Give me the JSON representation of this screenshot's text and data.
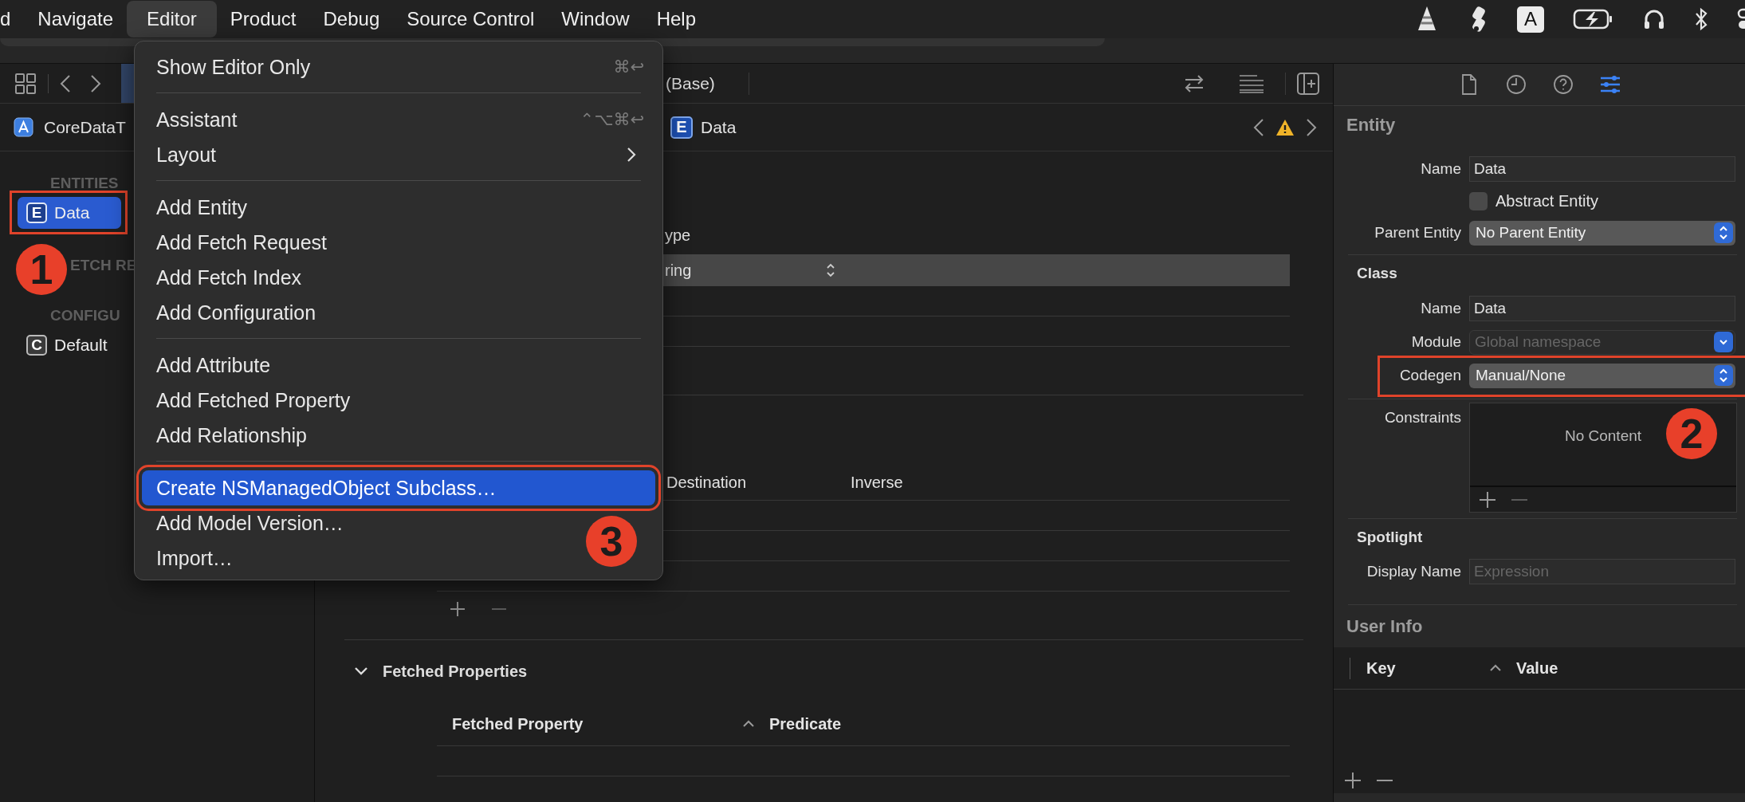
{
  "menu_bar": {
    "items": [
      {
        "label": "d",
        "selected": false
      },
      {
        "label": "Navigate",
        "selected": false
      },
      {
        "label": "Editor",
        "selected": true
      },
      {
        "label": "Product",
        "selected": false
      },
      {
        "label": "Debug",
        "selected": false
      },
      {
        "label": "Source Control",
        "selected": false
      },
      {
        "label": "Window",
        "selected": false
      },
      {
        "label": "Help",
        "selected": false
      }
    ],
    "input_source": "A"
  },
  "navigator": {
    "project": "CoreDataT",
    "annotation": "1",
    "sections": [
      {
        "title": "ENTITIES",
        "items": [
          {
            "badge": "E",
            "label": "Data",
            "selected": true,
            "highlighted": true
          }
        ]
      },
      {
        "title": "ETCH RE"
      },
      {
        "title": "CONFIGU",
        "items": [
          {
            "badge": "C",
            "label": "Default",
            "selected": false,
            "highlighted": false
          }
        ]
      }
    ]
  },
  "editor": {
    "tab_title": "(Base)",
    "breadcrumb": {
      "badge": "E",
      "label": "Data"
    },
    "attributes": {
      "column": "ype",
      "rows": [
        {
          "type": "ring",
          "selected": true
        }
      ]
    },
    "relationships": {
      "columns": [
        "Destination",
        "Inverse"
      ]
    },
    "fetched_properties": {
      "title": "Fetched Properties",
      "expanded": true,
      "columns": [
        {
          "label": "Fetched Property",
          "sorted": true
        },
        {
          "label": "Predicate",
          "sorted": false
        }
      ]
    }
  },
  "menu": {
    "annotation": "3",
    "items": [
      {
        "kind": "item",
        "label": "Show Editor Only",
        "shortcut": "⌘↩",
        "selected": false,
        "highlighted": false
      },
      {
        "kind": "separator"
      },
      {
        "kind": "item",
        "label": "Assistant",
        "shortcut": "⌃⌥⌘↩",
        "selected": false,
        "highlighted": false
      },
      {
        "kind": "item",
        "label": "Layout",
        "submenu": true,
        "selected": false,
        "highlighted": false
      },
      {
        "kind": "separator"
      },
      {
        "kind": "item",
        "label": "Add Entity",
        "selected": false,
        "highlighted": false
      },
      {
        "kind": "item",
        "label": "Add Fetch Request",
        "selected": false,
        "highlighted": false
      },
      {
        "kind": "item",
        "label": "Add Fetch Index",
        "selected": false,
        "highlighted": false
      },
      {
        "kind": "item",
        "label": "Add Configuration",
        "selected": false,
        "highlighted": false
      },
      {
        "kind": "separator"
      },
      {
        "kind": "item",
        "label": "Add Attribute",
        "selected": false,
        "highlighted": false
      },
      {
        "kind": "item",
        "label": "Add Fetched Property",
        "selected": false,
        "highlighted": false
      },
      {
        "kind": "item",
        "label": "Add Relationship",
        "selected": false,
        "highlighted": false
      },
      {
        "kind": "separator"
      },
      {
        "kind": "item",
        "label": "Create NSManagedObject Subclass…",
        "selected": true,
        "highlighted": true
      },
      {
        "kind": "item",
        "label": "Add Model Version…",
        "selected": false,
        "highlighted": false
      },
      {
        "kind": "item",
        "label": "Import…",
        "selected": false,
        "highlighted": false
      }
    ]
  },
  "inspector": {
    "tabs": [
      {
        "kind": "file",
        "selected": false
      },
      {
        "kind": "history",
        "selected": false
      },
      {
        "kind": "help",
        "selected": false
      },
      {
        "kind": "attributes",
        "selected": true
      }
    ],
    "entity": {
      "title": "Entity",
      "fields": [
        {
          "kind": "text",
          "label": "Name",
          "value": "Data",
          "highlighted": false
        },
        {
          "kind": "checkbox",
          "label": "Abstract Entity",
          "checked": false,
          "highlighted": false
        },
        {
          "kind": "popup",
          "label": "Parent Entity",
          "value": "No Parent Entity",
          "highlighted": false
        }
      ]
    },
    "class": {
      "title": "Class",
      "fields": [
        {
          "kind": "text",
          "label": "Name",
          "value": "Data",
          "highlighted": false
        },
        {
          "kind": "combo",
          "label": "Module",
          "placeholder": "Global namespace",
          "highlighted": false
        },
        {
          "kind": "popup",
          "label": "Codegen",
          "value": "Manual/None",
          "highlighted": true
        }
      ]
    },
    "constraints": {
      "label": "Constraints",
      "empty_text": "No Content",
      "annotation": "2"
    },
    "spotlight": {
      "title": "Spotlight",
      "fields": [
        {
          "kind": "text",
          "label": "Display Name",
          "placeholder": "Expression",
          "highlighted": false
        }
      ]
    },
    "user_info": {
      "title": "User Info",
      "columns": [
        {
          "label": "Key",
          "sorted": true
        },
        {
          "label": "Value",
          "sorted": false
        }
      ]
    }
  }
}
